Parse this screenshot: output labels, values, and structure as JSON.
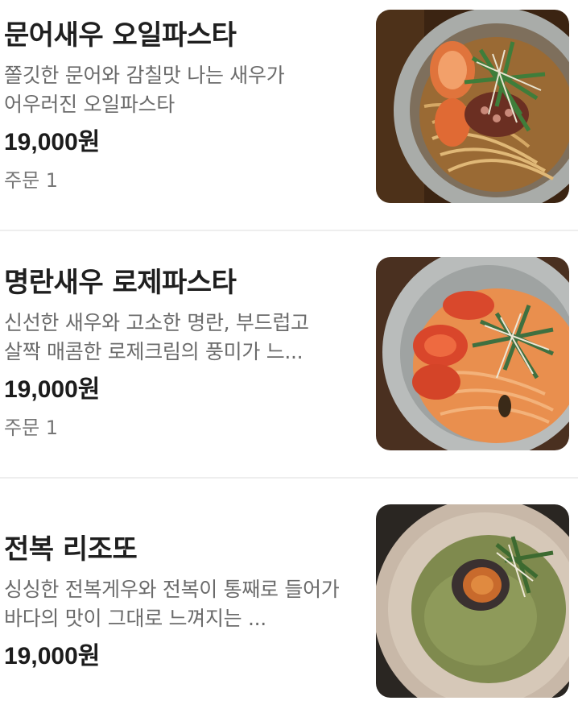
{
  "menu": {
    "items": [
      {
        "name": "문어새우 오일파스타",
        "description": "쫄깃한 문어와 감칠맛 나는 새우가 어우러진 오일파스타",
        "price": "19,000원",
        "orders": "주문 1"
      },
      {
        "name": "명란새우 로제파스타",
        "description": "신선한 새우와 고소한 명란, 부드럽고 살짝 매콤한 로제크림의 풍미가 느...",
        "price": "19,000원",
        "orders": "주문 1"
      },
      {
        "name": "전복 리조또",
        "description": "싱싱한 전복게우와 전복이 통째로 들어가 바다의 맛이 그대로 느껴지는 ...",
        "price": "19,000원"
      }
    ]
  },
  "colors": {
    "text_primary": "#1f1f1f",
    "text_secondary": "#6b6b6b",
    "divider": "#eeeeee"
  }
}
